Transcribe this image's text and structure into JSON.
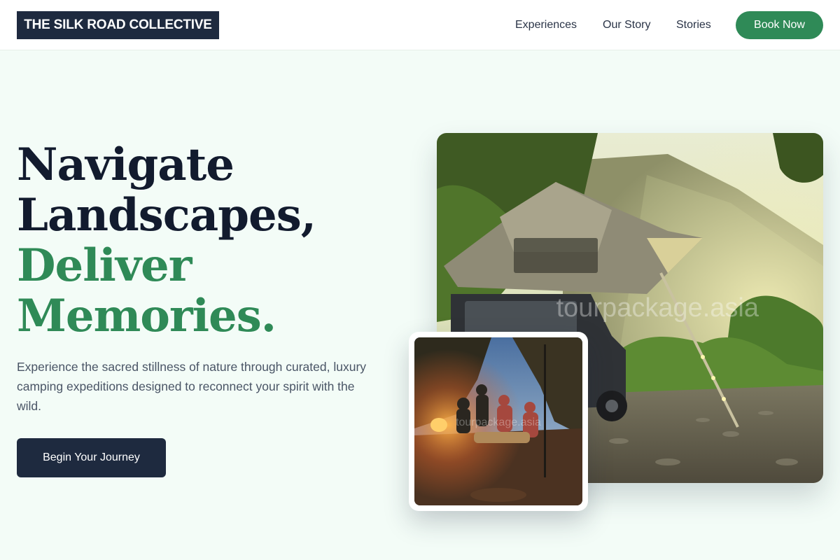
{
  "header": {
    "logo": "THE SILK ROAD COLLECTIVE",
    "nav": [
      "Experiences",
      "Our Story",
      "Stories"
    ],
    "book_label": "Book Now"
  },
  "hero": {
    "headline_line1": "Navigate",
    "headline_line2": "Landscapes,",
    "headline_line3": "Deliver",
    "headline_line4": "Memories.",
    "subtitle": "Experience the sacred stillness of nature through curated, luxury camping expeditions designed to reconnect your spirit with the wild.",
    "cta_label": "Begin Your Journey"
  },
  "images": {
    "main_watermark": "tourpackage.asia",
    "small_watermark": "tourpackage.asia"
  },
  "colors": {
    "brand_dark": "#1e2a3f",
    "brand_green": "#2f8a57",
    "background": "#f3fcf7"
  }
}
